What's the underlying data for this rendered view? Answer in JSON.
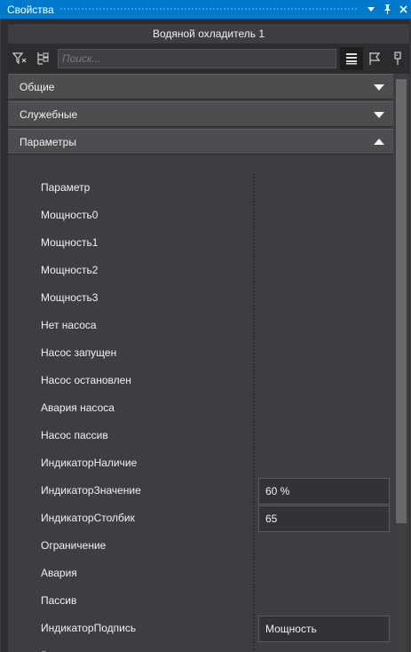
{
  "window": {
    "title": "Свойства",
    "buttons": [
      "▾",
      "⊥",
      "✕"
    ]
  },
  "object_name": "Водяной охладитель 1",
  "toolbar": {
    "search_placeholder": "Поиск..."
  },
  "categories": [
    {
      "label": "Общие",
      "expanded": false
    },
    {
      "label": "Служебные",
      "expanded": false
    },
    {
      "label": "Параметры",
      "expanded": true
    }
  ],
  "properties": [
    {
      "name": "Параметр",
      "value": ""
    },
    {
      "name": "Мощность0",
      "value": ""
    },
    {
      "name": "Мощность1",
      "value": ""
    },
    {
      "name": "Мощность2",
      "value": ""
    },
    {
      "name": "Мощность3",
      "value": ""
    },
    {
      "name": "Нет насоса",
      "value": ""
    },
    {
      "name": "Насос запущен",
      "value": ""
    },
    {
      "name": "Насос остановлен",
      "value": ""
    },
    {
      "name": "Авария насоса",
      "value": ""
    },
    {
      "name": "Насос пассив",
      "value": ""
    },
    {
      "name": "ИндикаторНаличие",
      "value": ""
    },
    {
      "name": "ИндикаторЗначение",
      "value": "60 %"
    },
    {
      "name": "ИндикаторСтолбик",
      "value": "65"
    },
    {
      "name": "Ограничение",
      "value": ""
    },
    {
      "name": "Авария",
      "value": ""
    },
    {
      "name": "Пассив",
      "value": ""
    },
    {
      "name": "ИндикаторПодпись",
      "value": "Мощность"
    },
    {
      "name": "Видимость",
      "value": ""
    }
  ],
  "colors": {
    "accent": "#007acc",
    "background": "#3e3e42",
    "category": "#4d4d50"
  }
}
